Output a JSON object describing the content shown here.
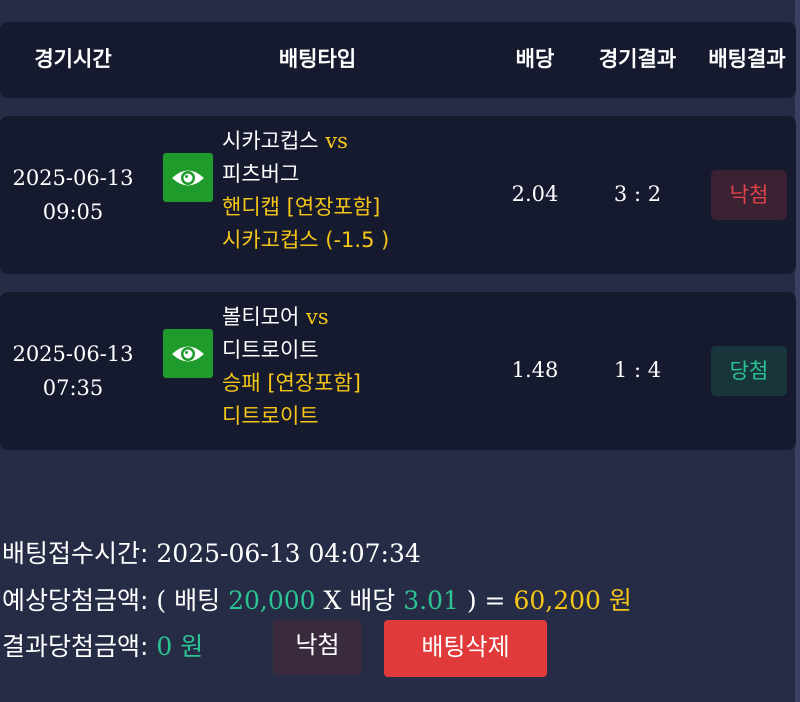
{
  "header": {
    "columns": [
      "경기시간",
      "배팅타입",
      "배당",
      "경기결과",
      "배팅결과"
    ]
  },
  "bets": [
    {
      "date": "2025-06-13",
      "time": "09:05",
      "home": "시카고컵스",
      "vs": "vs",
      "away": "피츠버그",
      "market": "핸디캡 [연장포함]",
      "pick": "시카고컵스 (-1.5 )",
      "odds": "2.04",
      "score": "3 : 2",
      "result": "낙첨"
    },
    {
      "date": "2025-06-13",
      "time": "07:35",
      "home": "볼티모어",
      "vs": "vs",
      "away": "디트로이트",
      "market": "승패 [연장포함]",
      "pick": "디트로이트",
      "odds": "1.48",
      "score": "1 : 4",
      "result": "당첨"
    }
  ],
  "summary": {
    "received_label": "배팅접수시간:",
    "received_value": "2025-06-13 04:07:34",
    "expected_label": "예상당첨금액:",
    "open_paren": "( ",
    "stake_label": "배팅",
    "stake_value": "20,000",
    "times": "X",
    "odds_label": "배당",
    "odds_value": "3.01",
    "close_paren": ") =",
    "payout_value": "60,200",
    "currency": "원",
    "result_label": "결과당첨금액:",
    "result_value": "0",
    "result_currency": "원"
  },
  "buttons": {
    "status": "낙첨",
    "delete": "배팅삭제"
  },
  "colors": {
    "background": "#262c45",
    "panel": "#151a2e",
    "accent_yellow": "#f5c518",
    "accent_teal": "#2bc393",
    "lose_red": "#e0414b",
    "delete_button": "#e03a3a",
    "eye_button": "#1e9b2a"
  },
  "icons": {
    "view": "eye-icon"
  }
}
